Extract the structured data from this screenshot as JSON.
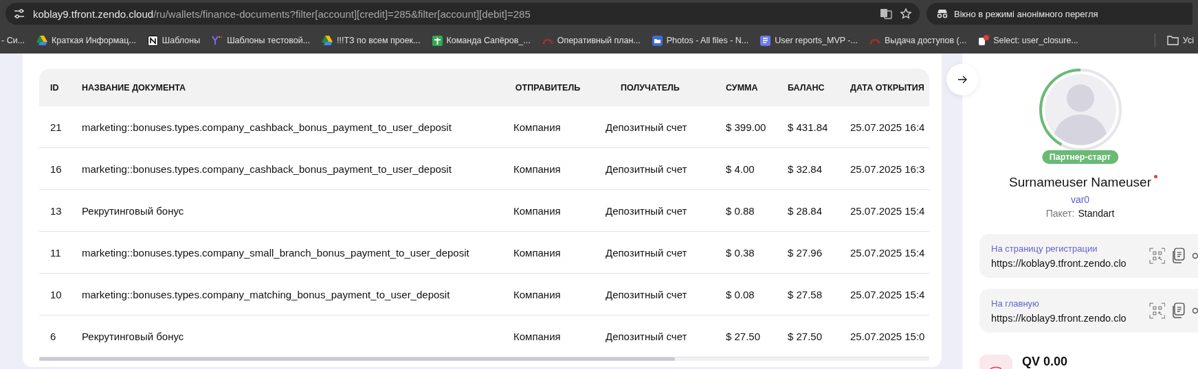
{
  "browser": {
    "url_host": "koblay9.tfront.zendo.cloud",
    "url_path": "/ru/wallets/finance-documents?filter[account][credit]=285&filter[account][debit]=285",
    "incognito_label": "Вікно в режимі анонімного перегля",
    "bookmarks": [
      {
        "label": "- Си...",
        "kind": "none"
      },
      {
        "label": "Краткая Информац...",
        "kind": "drive"
      },
      {
        "label": "Шаблоны",
        "kind": "notion"
      },
      {
        "label": "Шаблоны тестовой...",
        "kind": "yandex"
      },
      {
        "label": "!!!ТЗ по всем проек...",
        "kind": "drive"
      },
      {
        "label": "Команда Сапёров_...",
        "kind": "sheets"
      },
      {
        "label": "Оперативный план...",
        "kind": "redmine"
      },
      {
        "label": "Photos - All files - N...",
        "kind": "folder"
      },
      {
        "label": "User reports_MVP -...",
        "kind": "docs"
      },
      {
        "label": "Выдача доступов (...",
        "kind": "redmine"
      },
      {
        "label": "Select: user_closure...",
        "kind": "db"
      }
    ],
    "all_bookmarks": "Усі"
  },
  "table": {
    "columns": [
      "ID",
      "НАЗВАНИЕ ДОКУМЕНТА",
      "ОТПРАВИТЕЛЬ",
      "ПОЛУЧАТЕЛЬ",
      "СУММА",
      "БАЛАНС",
      "ДАТА ОТКРЫТИЯ"
    ],
    "rows": [
      [
        "21",
        "marketing::bonuses.types.company_cashback_bonus_payment_to_user_deposit",
        "Компания",
        "Депозитный счет",
        "$ 399.00",
        "$ 431.84",
        "25.07.2025 16:4"
      ],
      [
        "16",
        "marketing::bonuses.types.company_cashback_bonus_payment_to_user_deposit",
        "Компания",
        "Депозитный счет",
        "$ 4.00",
        "$ 32.84",
        "25.07.2025 16:3"
      ],
      [
        "13",
        "Рекрутинговый бонус",
        "Компания",
        "Депозитный счет",
        "$ 0.88",
        "$ 28.84",
        "25.07.2025 15:4"
      ],
      [
        "11",
        "marketing::bonuses.types.company_small_branch_bonus_payment_to_user_deposit",
        "Компания",
        "Депозитный счет",
        "$ 0.38",
        "$ 27.96",
        "25.07.2025 15:4"
      ],
      [
        "10",
        "marketing::bonuses.types.company_matching_bonus_payment_to_user_deposit",
        "Компания",
        "Депозитный счет",
        "$ 0.08",
        "$ 27.58",
        "25.07.2025 15:4"
      ],
      [
        "6",
        "Рекрутинговый бонус",
        "Компания",
        "Депозитный счет",
        "$ 27.50",
        "$ 27.50",
        "25.07.2025 15:0"
      ]
    ]
  },
  "profile": {
    "level": 0.42,
    "rank": "Партнер-старт",
    "name": "Surnameuser Nameuser",
    "online_dot": true,
    "login": "var0",
    "package_label": "Пакет:",
    "package": "Standart",
    "links": [
      {
        "label": "На страницу регистрации",
        "url": "https://koblay9.tfront.zendo.clo"
      },
      {
        "label": "На главную",
        "url": "https://koblay9.tfront.zendo.clo"
      }
    ],
    "qv": "QV 0.00"
  }
}
